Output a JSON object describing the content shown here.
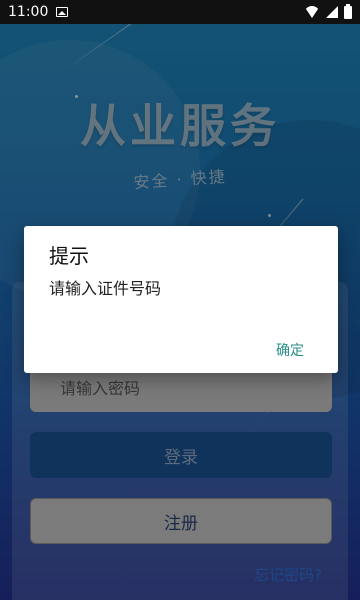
{
  "status_bar": {
    "time": "11:00",
    "icons": [
      "image-notification-icon",
      "wifi-icon",
      "signal-icon",
      "battery-icon"
    ]
  },
  "hero": {
    "title": "从业服务",
    "subtitle": "安全 · 快捷"
  },
  "form": {
    "password_placeholder": "请输入密码",
    "login_label": "登录",
    "register_label": "注册",
    "forgot_password_label": "忘记密码?"
  },
  "dialog": {
    "title": "提示",
    "message": "请输入证件号码",
    "confirm_label": "确定"
  },
  "colors": {
    "background_top": "#1f82b3",
    "background_bottom": "#22308a",
    "dialog_button": "#2a8f87",
    "forgot_link": "#2c6fcf"
  }
}
